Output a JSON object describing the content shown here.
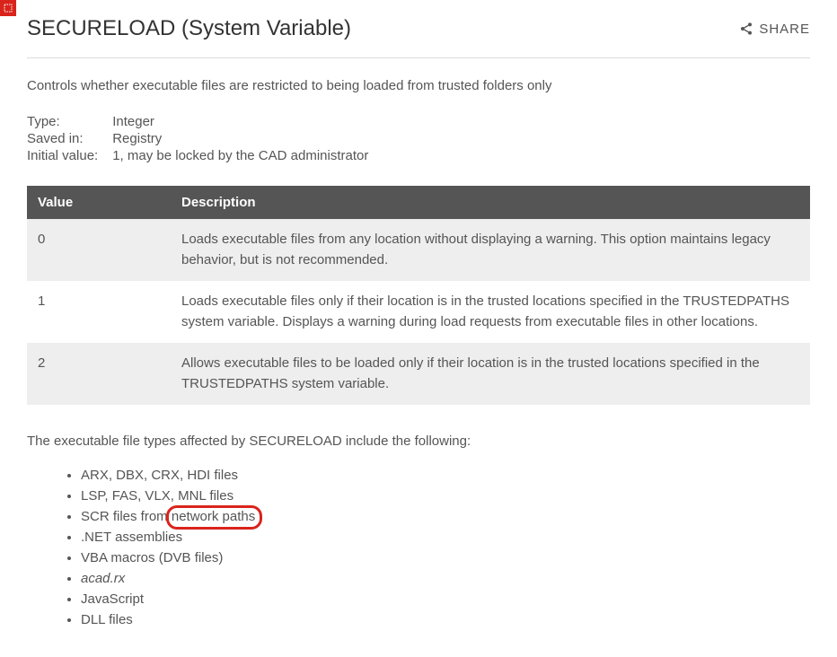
{
  "page": {
    "title": "SECURELOAD (System Variable)",
    "share_label": "SHARE",
    "intro": "Controls whether executable files are restricted to being loaded from trusted folders only"
  },
  "meta": {
    "rows": [
      {
        "label": "Type:",
        "value": "Integer"
      },
      {
        "label": "Saved in:",
        "value": "Registry"
      },
      {
        "label": "Initial value:",
        "value": "1, may be locked by the CAD administrator"
      }
    ]
  },
  "table": {
    "headers": {
      "col1": "Value",
      "col2": "Description"
    },
    "rows": [
      {
        "value": "0",
        "description": "Loads executable files from any location without displaying a warning. This option maintains legacy behavior, but is not recommended."
      },
      {
        "value": "1",
        "description": "Loads executable files only if their location is in the trusted locations specified in the TRUSTEDPATHS system variable. Displays a warning during load requests from executable files in other locations."
      },
      {
        "value": "2",
        "description": "Allows executable files to be loaded only if their location is in the trusted locations specified in the TRUSTEDPATHS system variable."
      }
    ]
  },
  "list": {
    "intro": "The executable file types affected by SECURELOAD include the following:",
    "items": {
      "i0": "ARX, DBX, CRX, HDI files",
      "i1": "LSP, FAS, VLX, MNL files",
      "i2_prefix": "SCR files from ",
      "i2_circled": "network paths",
      "i3": ".NET assemblies",
      "i4": "VBA macros (DVB files)",
      "i5": "acad.rx",
      "i6": "JavaScript",
      "i7": "DLL files"
    }
  }
}
